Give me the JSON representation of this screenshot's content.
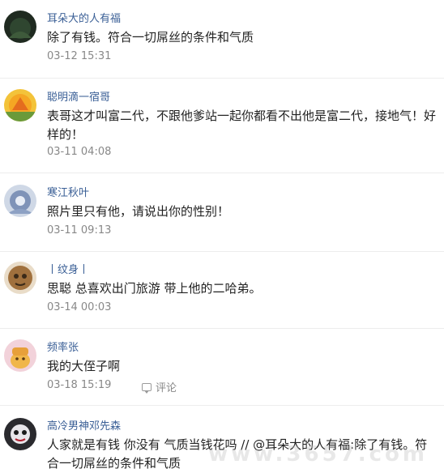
{
  "comments": [
    {
      "name": "耳朵大的人有福",
      "text": "除了有钱。符合一切屌丝的条件和气质",
      "time": "03-12 15:31"
    },
    {
      "name": "聪明滴一宿哥",
      "text": "表哥这才叫富二代，不跟他爹站一起你都看不出他是富二代，接地气！好样的！",
      "time": "03-11 04:08"
    },
    {
      "name": "寒江秋叶",
      "text": "照片里只有他，请说出你的性别！",
      "time": "03-11 09:13"
    },
    {
      "name": "丨纹身丨",
      "text": "思聪 总喜欢出门旅游 带上他的二哈弟。",
      "time": "03-14 00:03"
    },
    {
      "name": "频率张",
      "text": "我的大侄子啊",
      "time": "03-18 15:19",
      "reply_label": "评论"
    },
    {
      "name": "高冷男神邓先森",
      "text": "人家就是有钱 你没有 气质当钱花吗 // @耳朵大的人有福:除了有钱。符合一切屌丝的条件和气质",
      "time": ""
    }
  ],
  "watermark": "www.3657.com",
  "colors": {
    "name": "#3a5f96",
    "text": "#222222",
    "time": "#888888"
  },
  "icons": {
    "reply": "comment-bubble-icon"
  }
}
